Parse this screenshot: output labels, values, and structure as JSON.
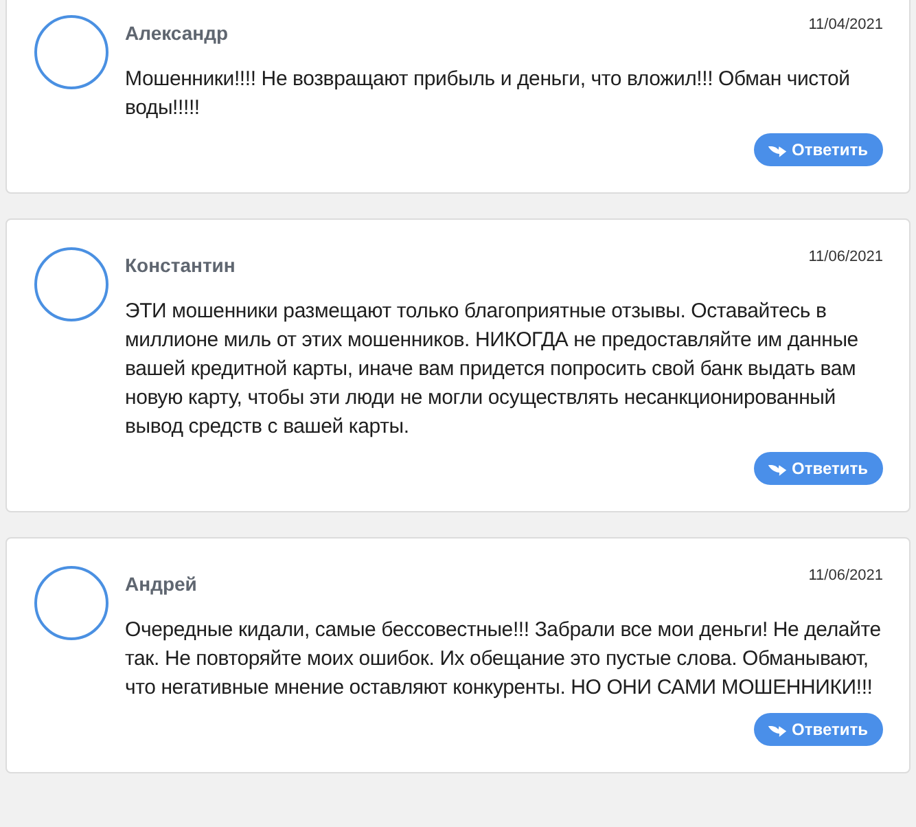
{
  "reviews": [
    {
      "author": "Александр",
      "date": "11/04/2021",
      "text": "Мошенники!!!! Не возвращают прибыль и деньги, что вложил!!! Обман чистой воды!!!!!",
      "reply_button": "Ответить"
    },
    {
      "author": "Константин",
      "date": "11/06/2021",
      "text": "ЭТИ мошенники размещают только благоприятные отзывы. Оставайтесь в миллионе миль от этих мошенников. НИКОГДА не предоставляйте им данные вашей кредитной карты, иначе вам придется попросить свой банк выдать вам новую карту, чтобы эти люди не могли осуществлять несанкционированный вывод средств с вашей карты.",
      "reply_button": "Ответить"
    },
    {
      "author": "Андрей",
      "date": "11/06/2021",
      "text": "Очередные кидали, самые бессовестные!!! Забрали все мои деньги! Не делайте так. Не повторяйте моих ошибок. Их обещание это пустые слова. Обманывают, что негативные мнение оставляют конкуренты. НО ОНИ САМИ МОШЕННИКИ!!!",
      "reply_button": "Ответить"
    }
  ]
}
